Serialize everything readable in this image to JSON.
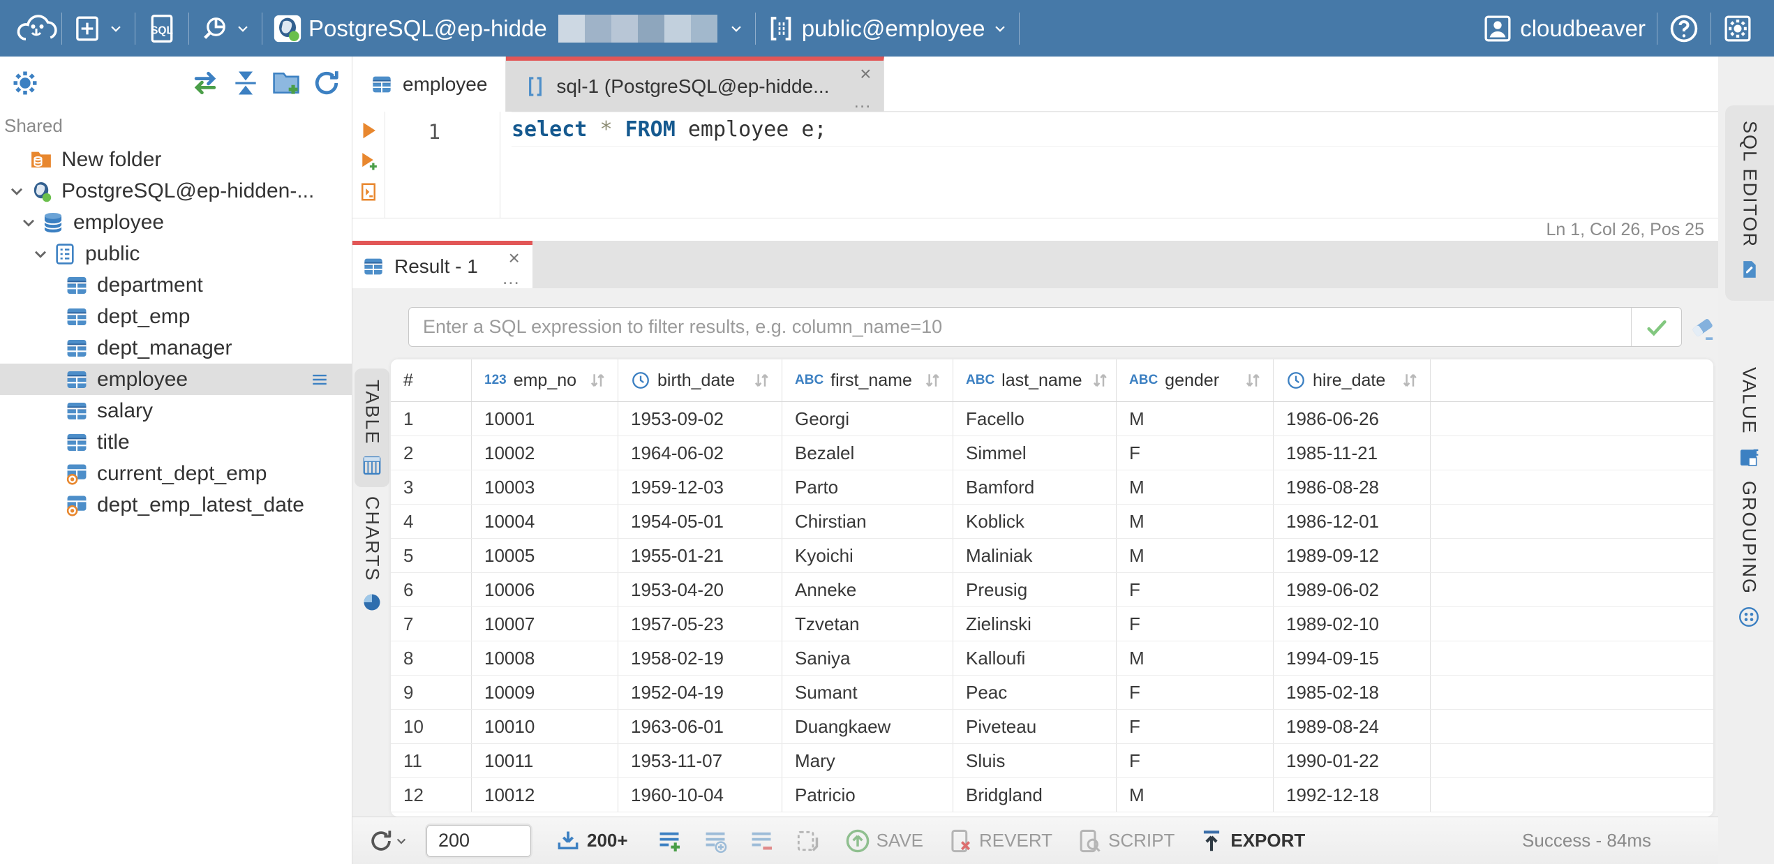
{
  "topbar": {
    "sql_badge": "SQL",
    "connection_name": "PostgreSQL@ep-hidde",
    "connection_redacted": true,
    "schema_selector": "public@employee",
    "username": "cloudbeaver"
  },
  "sidebar": {
    "section": "Shared",
    "tree": [
      {
        "label": "New folder",
        "icon": "folder-db",
        "level": 0,
        "chevron": false,
        "selected": false
      },
      {
        "label": "PostgreSQL@ep-hidden-...",
        "icon": "postgres",
        "level": 0,
        "chevron": true,
        "selected": false
      },
      {
        "label": "employee",
        "icon": "database",
        "level": 1,
        "chevron": true,
        "selected": false
      },
      {
        "label": "public",
        "icon": "schema",
        "level": 2,
        "chevron": true,
        "selected": false
      },
      {
        "label": "department",
        "icon": "table",
        "level": 3,
        "chevron": false,
        "selected": false
      },
      {
        "label": "dept_emp",
        "icon": "table",
        "level": 3,
        "chevron": false,
        "selected": false
      },
      {
        "label": "dept_manager",
        "icon": "table",
        "level": 3,
        "chevron": false,
        "selected": false
      },
      {
        "label": "employee",
        "icon": "table",
        "level": 3,
        "chevron": false,
        "selected": true
      },
      {
        "label": "salary",
        "icon": "table",
        "level": 3,
        "chevron": false,
        "selected": false
      },
      {
        "label": "title",
        "icon": "table",
        "level": 3,
        "chevron": false,
        "selected": false
      },
      {
        "label": "current_dept_emp",
        "icon": "view",
        "level": 3,
        "chevron": false,
        "selected": false
      },
      {
        "label": "dept_emp_latest_date",
        "icon": "view",
        "level": 3,
        "chevron": false,
        "selected": false
      }
    ]
  },
  "editor": {
    "tabs": [
      {
        "label": "employee",
        "icon": "table",
        "active": false,
        "closable": false
      },
      {
        "label": "sql-1 (PostgreSQL@ep-hidde...",
        "icon": "sql-script",
        "active": true,
        "closable": true
      }
    ],
    "line_number": "1",
    "sql": [
      {
        "text": "select",
        "type": "keyword"
      },
      {
        "text": " ",
        "type": "plain"
      },
      {
        "text": "*",
        "type": "star"
      },
      {
        "text": " ",
        "type": "plain"
      },
      {
        "text": "FROM",
        "type": "keyword"
      },
      {
        "text": " employee e;",
        "type": "plain"
      }
    ],
    "caret_status": "Ln 1, Col 26, Pos 25",
    "side_tab": "SQL EDITOR"
  },
  "result": {
    "tab_label": "Result - 1",
    "filter_placeholder": "Enter a SQL expression to filter results, e.g. column_name=10",
    "left_tabs": [
      {
        "label": "TABLE",
        "icon": "table-grid",
        "active": true
      },
      {
        "label": "CHARTS",
        "icon": "pie",
        "active": false
      }
    ],
    "right_tabs": [
      {
        "label": "VALUE",
        "icon": "value-panel"
      },
      {
        "label": "GROUPING",
        "icon": "grouping"
      }
    ],
    "grid": {
      "columns": [
        {
          "label": "#",
          "type": ""
        },
        {
          "label": "emp_no",
          "type": "num"
        },
        {
          "label": "birth_date",
          "type": "date"
        },
        {
          "label": "first_name",
          "type": "text"
        },
        {
          "label": "last_name",
          "type": "text"
        },
        {
          "label": "gender",
          "type": "text"
        },
        {
          "label": "hire_date",
          "type": "date"
        }
      ],
      "type_badges": {
        "num": "123",
        "text": "ABC"
      },
      "rows": [
        [
          "1",
          "10001",
          "1953-09-02",
          "Georgi",
          "Facello",
          "M",
          "1986-06-26"
        ],
        [
          "2",
          "10002",
          "1964-06-02",
          "Bezalel",
          "Simmel",
          "F",
          "1985-11-21"
        ],
        [
          "3",
          "10003",
          "1959-12-03",
          "Parto",
          "Bamford",
          "M",
          "1986-08-28"
        ],
        [
          "4",
          "10004",
          "1954-05-01",
          "Chirstian",
          "Koblick",
          "M",
          "1986-12-01"
        ],
        [
          "5",
          "10005",
          "1955-01-21",
          "Kyoichi",
          "Maliniak",
          "M",
          "1989-09-12"
        ],
        [
          "6",
          "10006",
          "1953-04-20",
          "Anneke",
          "Preusig",
          "F",
          "1989-06-02"
        ],
        [
          "7",
          "10007",
          "1957-05-23",
          "Tzvetan",
          "Zielinski",
          "F",
          "1989-02-10"
        ],
        [
          "8",
          "10008",
          "1958-02-19",
          "Saniya",
          "Kalloufi",
          "M",
          "1994-09-15"
        ],
        [
          "9",
          "10009",
          "1952-04-19",
          "Sumant",
          "Peac",
          "F",
          "1985-02-18"
        ],
        [
          "10",
          "10010",
          "1963-06-01",
          "Duangkaew",
          "Piveteau",
          "F",
          "1989-08-24"
        ],
        [
          "11",
          "10011",
          "1953-11-07",
          "Mary",
          "Sluis",
          "F",
          "1990-01-22"
        ],
        [
          "12",
          "10012",
          "1960-10-04",
          "Patricio",
          "Bridgland",
          "M",
          "1992-12-18"
        ]
      ]
    },
    "toolbar": {
      "row_limit": "200",
      "fetch_more": "200+",
      "save": "SAVE",
      "revert": "REVERT",
      "script": "SCRIPT",
      "export": "EXPORT",
      "status": "Success - 84ms"
    }
  },
  "colors": {
    "topbar": "#4679a8",
    "accent_red": "#e25656",
    "icon_blue": "#3c80c2",
    "success_green": "#6abf4b"
  }
}
